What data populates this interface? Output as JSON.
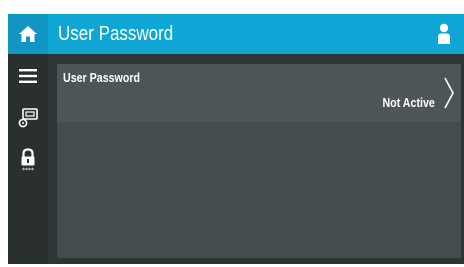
{
  "header": {
    "title": "User Password",
    "home_icon": "home-icon",
    "user_icon": "user-icon",
    "color": "#0fa6d6"
  },
  "sidebar": {
    "items": [
      {
        "icon": "menu-icon"
      },
      {
        "icon": "settings-icon"
      },
      {
        "icon": "lock-icon"
      }
    ]
  },
  "main": {
    "rows": [
      {
        "label": "User Password",
        "value": "Not Active",
        "icon": "chevron-right-icon"
      }
    ]
  }
}
